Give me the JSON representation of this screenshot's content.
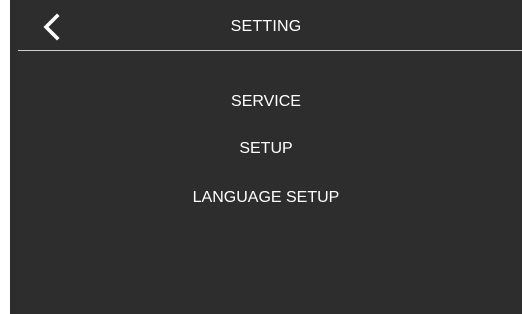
{
  "header": {
    "title": "SETTING",
    "back_icon": "chevron-left-icon"
  },
  "menu": {
    "items": [
      {
        "label": "SERVICE"
      },
      {
        "label": "SETUP"
      },
      {
        "label": "LANGUAGE SETUP"
      }
    ]
  },
  "colors": {
    "background": "#2d2d2d",
    "text": "#ffffff",
    "divider": "#cfcfcf"
  }
}
